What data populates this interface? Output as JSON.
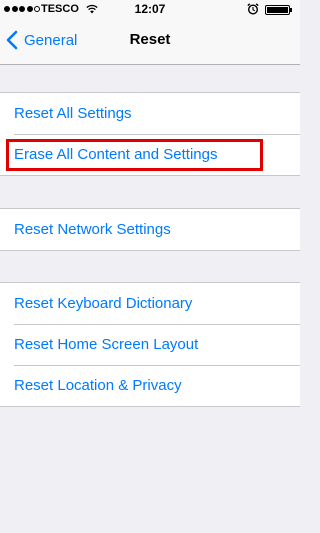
{
  "status_bar": {
    "carrier": "TESCO",
    "time": "12:07",
    "signal_icon": "signal-dots-icon",
    "wifi_icon": "wifi-icon",
    "alarm_icon": "alarm-icon",
    "battery_icon": "battery-icon",
    "signal_strength_filled": 4,
    "signal_strength_total": 5
  },
  "nav_bar": {
    "back_label": "General",
    "title": "Reset"
  },
  "groups": [
    {
      "items": [
        {
          "label": "Reset All Settings"
        },
        {
          "label": "Erase All Content and Settings"
        }
      ]
    },
    {
      "items": [
        {
          "label": "Reset Network Settings"
        }
      ]
    },
    {
      "items": [
        {
          "label": "Reset Keyboard Dictionary"
        },
        {
          "label": "Reset Home Screen Layout"
        },
        {
          "label": "Reset Location & Privacy"
        }
      ]
    }
  ],
  "colors": {
    "accent": "#007aff",
    "background": "#efeff4",
    "highlight_box": "#e00000"
  }
}
